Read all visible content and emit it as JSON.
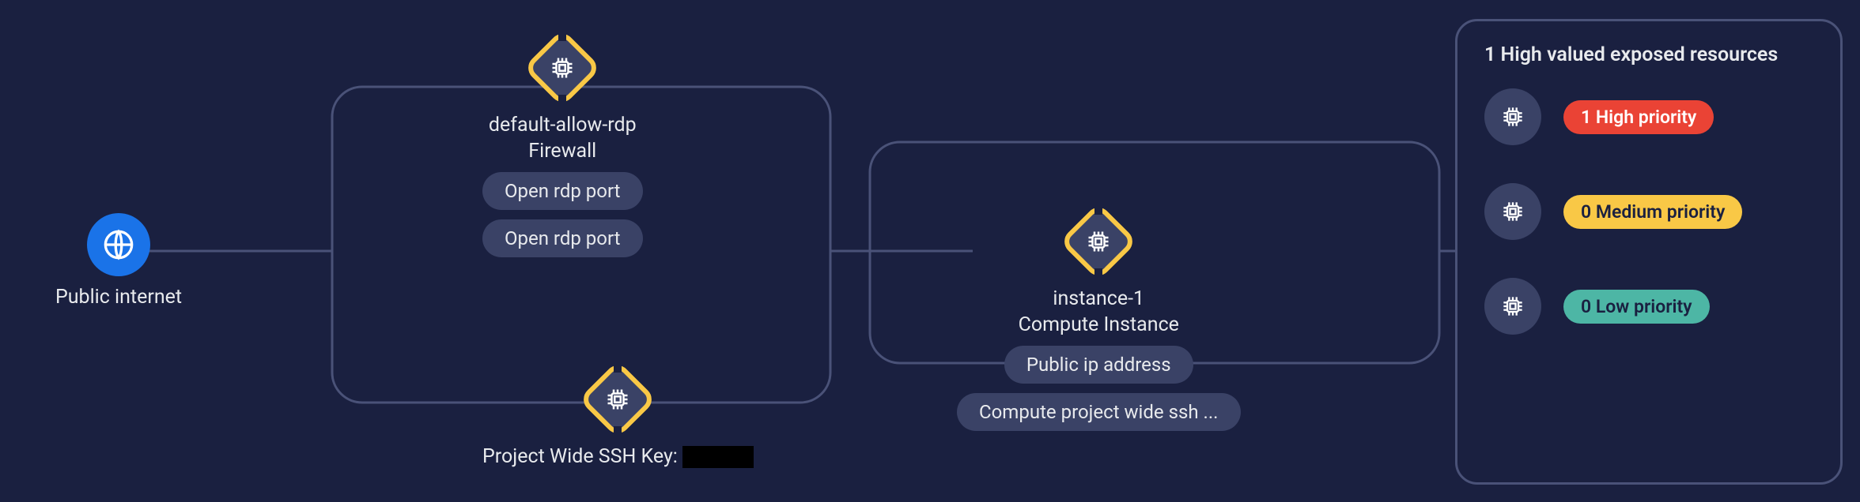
{
  "nodes": {
    "internet": {
      "label": "Public internet"
    },
    "firewall": {
      "title": "default-allow-rdp",
      "subtitle": "Firewall",
      "pills": [
        "Open rdp port",
        "Open rdp port"
      ]
    },
    "sshkey": {
      "title_prefix": "Project Wide SSH Key:"
    },
    "instance": {
      "title": "instance-1",
      "subtitle": "Compute Instance",
      "pills": [
        "Public ip address",
        "Compute project wide ssh ..."
      ]
    }
  },
  "panel": {
    "title": "1 High valued exposed resources",
    "priorities": [
      {
        "label": "1 High priority",
        "class": "badge-high"
      },
      {
        "label": "0 Medium priority",
        "class": "badge-med"
      },
      {
        "label": "0 Low priority",
        "class": "badge-low"
      }
    ]
  }
}
